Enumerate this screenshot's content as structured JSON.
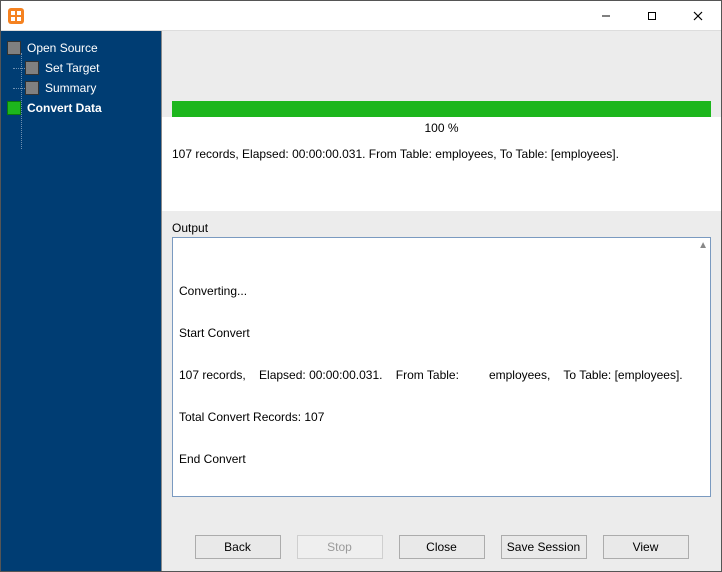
{
  "titlebar": {
    "title": ""
  },
  "sidebar": {
    "items": [
      {
        "label": "Open Source",
        "active": false
      },
      {
        "label": "Set Target",
        "active": false
      },
      {
        "label": "Summary",
        "active": false
      },
      {
        "label": "Convert Data",
        "active": true
      }
    ]
  },
  "progress": {
    "percent": 100,
    "percent_text": "100 %"
  },
  "status": {
    "records": 107,
    "elapsed": "00:00:00.031",
    "from_table": "employees",
    "to_table": "[employees]",
    "line": "107 records,    Elapsed: 00:00:00.031.    From Table:         employees,    To Table: [employees]."
  },
  "output": {
    "label": "Output",
    "lines": [
      "Converting...",
      "Start Convert",
      "107 records,    Elapsed: 00:00:00.031.    From Table:         employees,    To Table: [employees].",
      "Total Convert Records: 107",
      "End Convert",
      "|"
    ]
  },
  "buttons": {
    "back": "Back",
    "stop": "Stop",
    "close": "Close",
    "save_session": "Save Session",
    "view": "View"
  },
  "colors": {
    "sidebar_bg": "#003d73",
    "progress_fill": "#1db61d",
    "panel_bg": "#ececec"
  }
}
